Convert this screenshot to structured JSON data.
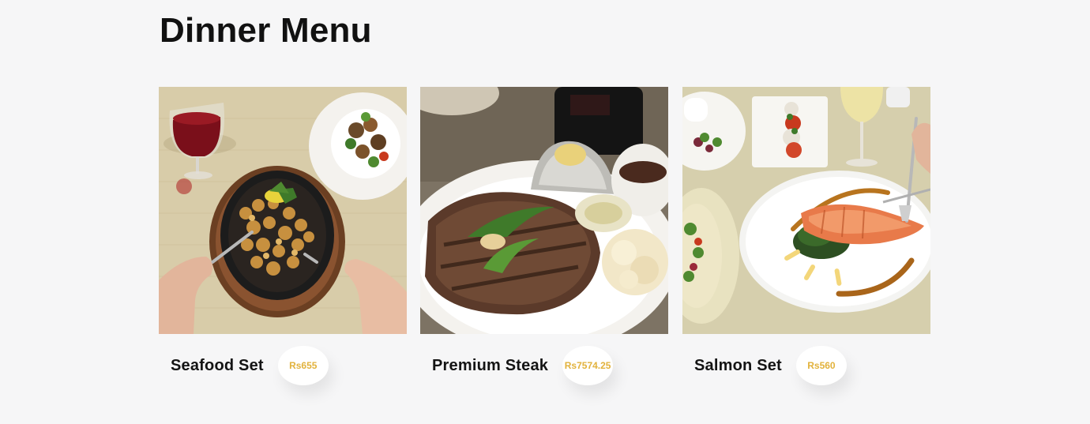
{
  "page": {
    "title": "Dinner Menu"
  },
  "menu_items": [
    {
      "name": "Seafood Set",
      "price": "Rs655",
      "image_icon": "seafood-set-photo"
    },
    {
      "name": "Premium Steak",
      "price": "Rs7574.25",
      "image_icon": "premium-steak-photo"
    },
    {
      "name": "Salmon Set",
      "price": "Rs560",
      "image_icon": "salmon-set-photo"
    }
  ],
  "colors": {
    "background": "#f6f6f7",
    "title": "#111111",
    "price_text": "#e2b23c",
    "badge_bg": "#ffffff"
  }
}
